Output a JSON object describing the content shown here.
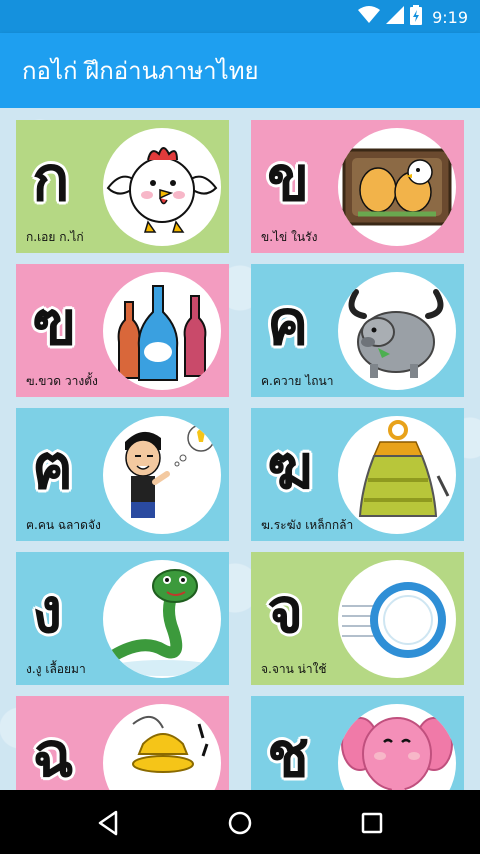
{
  "status_bar": {
    "time": "9:19",
    "icons": [
      "wifi-icon",
      "signal-icon",
      "battery-charging-icon"
    ]
  },
  "app_bar": {
    "title": "กอไก่ ฝึกอ่านภาษาไทย"
  },
  "cards": [
    {
      "letter": "ก",
      "caption": "ก.เอย ก.ไก่",
      "color": "#b5d884",
      "picture": "chicken-icon"
    },
    {
      "letter": "ข",
      "caption": "ข.ไข่ ในรัง",
      "color": "#f39cc0",
      "picture": "eggs-in-nest-icon"
    },
    {
      "letter": "ฃ",
      "caption": "ฃ.ขวด วางตั้ง",
      "color": "#f39cc0",
      "picture": "bottles-icon"
    },
    {
      "letter": "ค",
      "caption": "ค.ควาย ไถนา",
      "color": "#7dd0e6",
      "picture": "buffalo-icon"
    },
    {
      "letter": "ฅ",
      "caption": "ฅ.คน ฉลาดจัง",
      "color": "#7dd0e6",
      "picture": "smart-person-icon"
    },
    {
      "letter": "ฆ",
      "caption": "ฆ.ระฆัง เหล็กกล้า",
      "color": "#7dd0e6",
      "picture": "bell-icon"
    },
    {
      "letter": "ง",
      "caption": "ง.งู เลื้อยมา",
      "color": "#7dd0e6",
      "picture": "snake-icon"
    },
    {
      "letter": "จ",
      "caption": "จ.จาน น่าใช้",
      "color": "#b5d884",
      "picture": "plate-icon"
    },
    {
      "letter": "ฉ",
      "caption": "",
      "color": "#f39cc0",
      "picture": "cymbals-icon"
    },
    {
      "letter": "ช",
      "caption": "",
      "color": "#7dd0e6",
      "picture": "elephant-icon"
    }
  ],
  "nav_bar": {
    "buttons": [
      "back-icon",
      "home-icon",
      "recents-icon"
    ]
  }
}
